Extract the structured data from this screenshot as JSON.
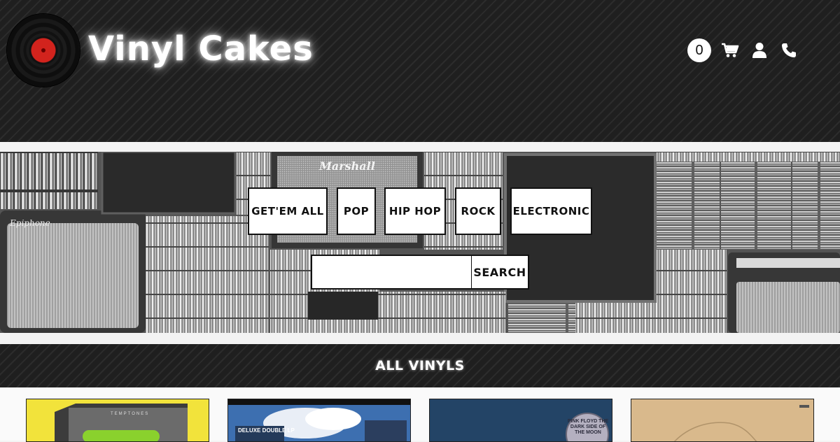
{
  "header": {
    "brand": "Vinyl Cakes",
    "cart_count": "0",
    "icons": [
      "vinyl-record-logo",
      "cart-icon",
      "user-icon",
      "phone-icon"
    ]
  },
  "hero": {
    "genres": [
      "GET'EM ALL",
      "POP",
      "HIP HOP",
      "ROCK",
      "ELECTRONIC"
    ],
    "search": {
      "placeholder": "",
      "value": "",
      "button_label": "SEARCH"
    },
    "amp_brand_text": "Marshall",
    "amp_brand_text_2": "Epiphone"
  },
  "section": {
    "title": "ALL VINYLS"
  },
  "products": [
    {
      "art_color": "#f2e33b",
      "caption": ""
    },
    {
      "art_color": "#3d6fb0",
      "caption": "DELUXE DOUBLE LP"
    },
    {
      "art_color": "#1d3a5a",
      "caption": "PINK FLOYD THE DARK SIDE OF THE MOON"
    },
    {
      "art_color": "#d9b98c",
      "caption": ""
    }
  ],
  "colors": {
    "accent": "#d2231d",
    "header_bg": "#1f1f1f",
    "button_bg": "#ffffff"
  }
}
